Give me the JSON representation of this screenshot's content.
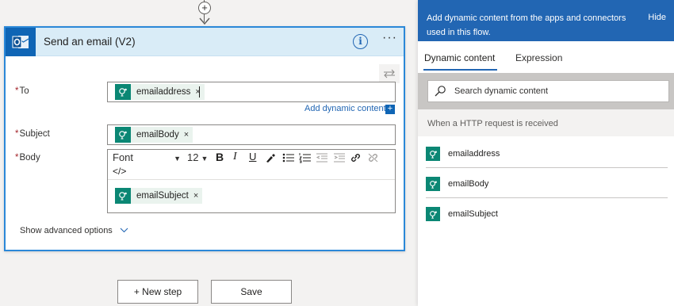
{
  "connector": {
    "add_symbol": "+"
  },
  "card": {
    "title": "Send an email (V2)",
    "info_symbol": "i",
    "more_symbol": "···"
  },
  "fields": {
    "required_marker": "*",
    "to": {
      "label": "To",
      "token": "emailaddress"
    },
    "subject": {
      "label": "Subject",
      "token": "emailBody"
    },
    "body": {
      "label": "Body",
      "token": "emailSubject"
    }
  },
  "token_close": "×",
  "add_dynamic_content": "Add dynamic content",
  "add_dynamic_symbol": "+",
  "editor": {
    "font": "Font",
    "font_size": "12",
    "dropdown_symbol": "▼",
    "bold": "B",
    "italic": "I",
    "underline": "U",
    "code_view": "</>"
  },
  "advanced_options": "Show advanced options",
  "buttons": {
    "new_step": "+ New step",
    "save": "Save"
  },
  "panel": {
    "header_text": "Add dynamic content from the apps and connectors used in this flow.",
    "hide": "Hide",
    "tabs": [
      "Dynamic content",
      "Expression"
    ],
    "search_placeholder": "Search dynamic content",
    "section_title": "When a HTTP request is received",
    "items": [
      "emailaddress",
      "emailBody",
      "emailSubject"
    ]
  },
  "colors": {
    "accent": "#2266b3",
    "token": "#0b8774",
    "outlook": "#0f65b5",
    "required": "#a4262c"
  }
}
